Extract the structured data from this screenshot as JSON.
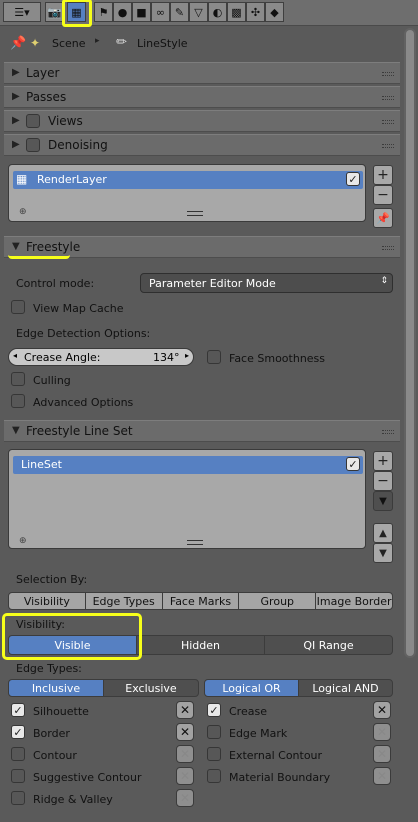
{
  "header": {
    "tabs": [
      "render-icon",
      "render-layers-icon",
      "scene-icon",
      "world-icon",
      "object-icon",
      "constraints-icon",
      "modifiers-icon",
      "data-icon",
      "material-icon",
      "texture-icon",
      "particles-icon",
      "physics-icon"
    ]
  },
  "context": {
    "scene_label": "Scene",
    "linestyle_label": "LineStyle"
  },
  "panels": {
    "layer": "Layer",
    "passes": "Passes",
    "views": "Views",
    "denoising": "Denoising",
    "freestyle": "Freestyle",
    "freestyle_line_set": "Freestyle Line Set"
  },
  "render_layers": {
    "items": [
      "RenderLayer"
    ]
  },
  "freestyle": {
    "control_mode_label": "Control mode:",
    "control_mode_value": "Parameter Editor Mode",
    "view_map_cache": "View Map Cache",
    "edge_detection_options": "Edge Detection Options:",
    "crease_angle_label": "Crease Angle:",
    "crease_angle_value": "134°",
    "face_smoothness": "Face Smoothness",
    "culling": "Culling",
    "advanced_options": "Advanced Options"
  },
  "line_sets": {
    "items": [
      "LineSet"
    ]
  },
  "selection": {
    "label": "Selection By:",
    "buttons": [
      "Visibility",
      "Edge Types",
      "Face Marks",
      "Group",
      "Image Border"
    ],
    "visibility_label": "Visibility:",
    "visibility_options": [
      "Visible",
      "Hidden",
      "QI Range"
    ],
    "edge_types_label": "Edge Types:",
    "inclusive": "Inclusive",
    "exclusive": "Exclusive",
    "logical_or": "Logical OR",
    "logical_and": "Logical AND",
    "edges_left": [
      {
        "label": "Silhouette",
        "checked": true
      },
      {
        "label": "Border",
        "checked": true
      },
      {
        "label": "Contour",
        "checked": false
      },
      {
        "label": "Suggestive Contour",
        "checked": false
      },
      {
        "label": "Ridge & Valley",
        "checked": false
      }
    ],
    "edges_right": [
      {
        "label": "Crease",
        "checked": true
      },
      {
        "label": "Edge Mark",
        "checked": false
      },
      {
        "label": "External Contour",
        "checked": false
      },
      {
        "label": "Material Boundary",
        "checked": false
      }
    ]
  },
  "colors": {
    "highlight": "#f7ff1a",
    "selected_blue": "#5680c2",
    "panel_bg": "#5a5a5a"
  }
}
